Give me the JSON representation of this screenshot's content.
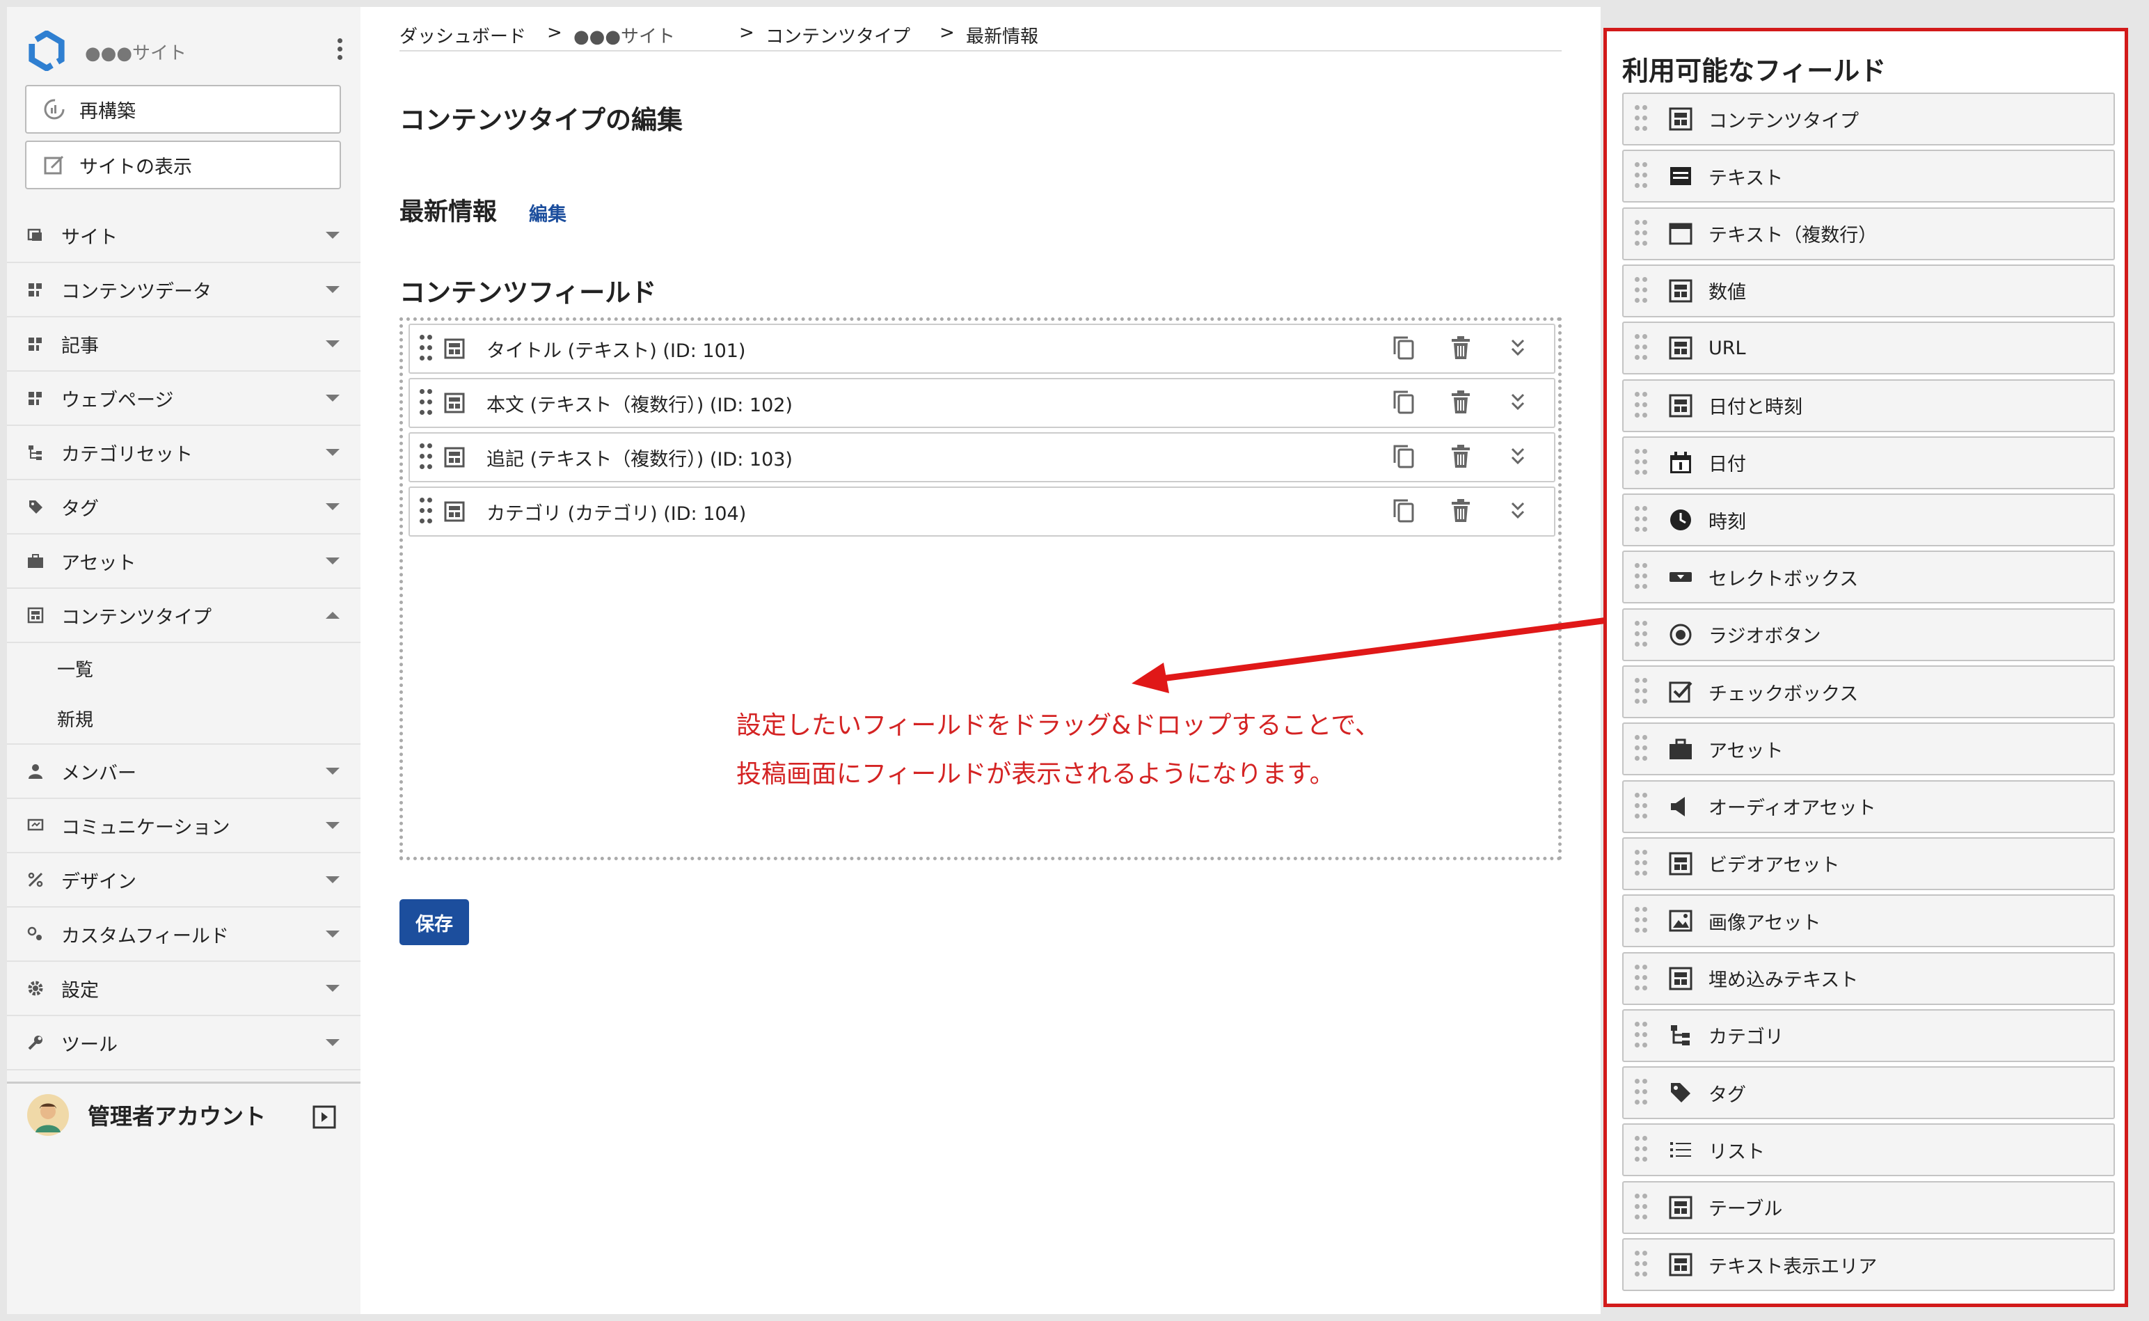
{
  "breadcrumb": {
    "items": [
      "ダッシュボード",
      "●●●サイト",
      "コンテンツタイプ",
      "最新情報"
    ],
    "separator": ">"
  },
  "sidebar": {
    "site_name": "●●●サイト",
    "rebuild_label": "再構築",
    "view_site_label": "サイトの表示",
    "nav": [
      {
        "label": "サイト",
        "icon": "site-icon"
      },
      {
        "label": "コンテンツデータ",
        "icon": "content-data-icon"
      },
      {
        "label": "記事",
        "icon": "article-icon"
      },
      {
        "label": "ウェブページ",
        "icon": "webpage-icon"
      },
      {
        "label": "カテゴリセット",
        "icon": "category-set-icon"
      },
      {
        "label": "タグ",
        "icon": "tag-icon"
      },
      {
        "label": "アセット",
        "icon": "asset-icon"
      },
      {
        "label": "コンテンツタイプ",
        "icon": "content-type-icon",
        "expanded": true
      },
      {
        "label": "メンバー",
        "icon": "member-icon"
      },
      {
        "label": "コミュニケーション",
        "icon": "communication-icon"
      },
      {
        "label": "デザイン",
        "icon": "design-icon"
      },
      {
        "label": "カスタムフィールド",
        "icon": "custom-field-icon"
      },
      {
        "label": "設定",
        "icon": "gear-icon"
      },
      {
        "label": "ツール",
        "icon": "wrench-icon"
      }
    ],
    "content_type_sub": [
      "一覧",
      "新規"
    ],
    "account_name": "管理者アカウント"
  },
  "main": {
    "page_title": "コンテンツタイプの編集",
    "type_name": "最新情報",
    "edit_label": "編集",
    "fields_title": "コンテンツフィールド",
    "fields": [
      {
        "label": "タイトル (テキスト) (ID: 101)"
      },
      {
        "label": "本文 (テキスト（複数行）) (ID: 102)"
      },
      {
        "label": "追記 (テキスト（複数行）) (ID: 103)"
      },
      {
        "label": "カテゴリ (カテゴリ) (ID: 104)"
      }
    ],
    "annotation_line1": "設定したいフィールドをドラッグ&ドロップすることで、",
    "annotation_line2": "投稿画面にフィールドが表示されるようになります。",
    "save_label": "保存"
  },
  "available": {
    "title": "利用可能なフィールド",
    "items": [
      {
        "label": "コンテンツタイプ",
        "icon": "content-type-icon"
      },
      {
        "label": "テキスト",
        "icon": "text-icon"
      },
      {
        "label": "テキスト（複数行）",
        "icon": "multiline-text-icon"
      },
      {
        "label": "数値",
        "icon": "number-icon"
      },
      {
        "label": "URL",
        "icon": "url-icon"
      },
      {
        "label": "日付と時刻",
        "icon": "datetime-icon"
      },
      {
        "label": "日付",
        "icon": "calendar-icon"
      },
      {
        "label": "時刻",
        "icon": "clock-icon"
      },
      {
        "label": "セレクトボックス",
        "icon": "select-box-icon"
      },
      {
        "label": "ラジオボタン",
        "icon": "radio-button-icon"
      },
      {
        "label": "チェックボックス",
        "icon": "checkbox-icon"
      },
      {
        "label": "アセット",
        "icon": "asset-icon"
      },
      {
        "label": "オーディオアセット",
        "icon": "audio-icon"
      },
      {
        "label": "ビデオアセット",
        "icon": "video-icon"
      },
      {
        "label": "画像アセット",
        "icon": "image-icon"
      },
      {
        "label": "埋め込みテキスト",
        "icon": "embed-text-icon"
      },
      {
        "label": "カテゴリ",
        "icon": "category-icon"
      },
      {
        "label": "タグ",
        "icon": "tag-icon"
      },
      {
        "label": "リスト",
        "icon": "list-icon"
      },
      {
        "label": "テーブル",
        "icon": "table-icon"
      },
      {
        "label": "テキスト表示エリア",
        "icon": "text-display-icon"
      }
    ]
  },
  "colors": {
    "accent": "#1c4e9d",
    "annotation": "#d42323",
    "panel_border": "#d21a1a"
  }
}
